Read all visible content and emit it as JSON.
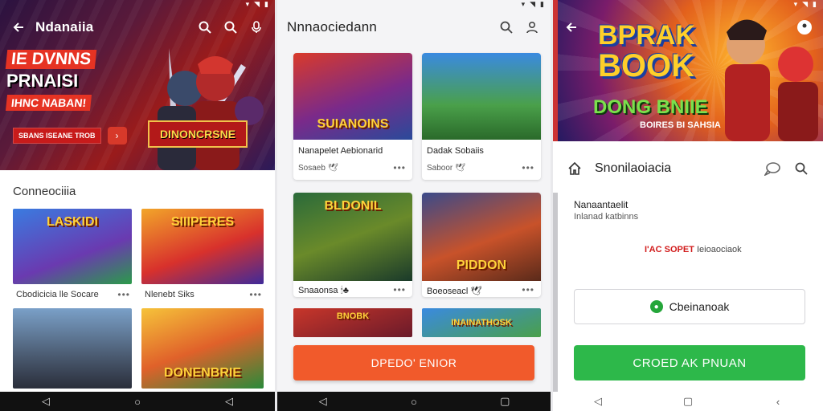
{
  "status_icons": {
    "signal": "▾",
    "wifi": "◥",
    "battery": "▮"
  },
  "phone1": {
    "title": "Ndanaiia",
    "promo": {
      "line1": "IE DVNNS",
      "line2": "PRNAISI",
      "line3": "IHNC NABAN!",
      "cta": "SBANS ISEANE TROB",
      "arrow": "›"
    },
    "hero_logo": "DINONCRSNE",
    "section_title": "Conneociiia",
    "games": [
      {
        "banner": "LASKIDI",
        "title": "Cbodicicia lle Socare"
      },
      {
        "banner": "SIIIPERES",
        "title": "Nlenebt Siks"
      },
      {
        "banner": "",
        "title": ""
      },
      {
        "banner": "DONENBRIE",
        "title": ""
      }
    ]
  },
  "phone2": {
    "title": "Nnnaociedann",
    "cards": [
      {
        "banner": "SUIANOINS",
        "title": "Nanapelet Aebionarid",
        "sub": "Sosaeb 🕊"
      },
      {
        "banner": "",
        "title": "Dadak Sobaiis",
        "sub": "Saboor 🕊"
      },
      {
        "banner": "BLDONIL",
        "title": "Snaaonsa 🕯♣",
        "sub": ""
      },
      {
        "banner": "PIDDON",
        "title": "Boeoseacl 🕊",
        "sub": ""
      },
      {
        "banner": "BNOBK",
        "title": "",
        "sub": ""
      },
      {
        "banner": "INAINATHOSK",
        "title": "",
        "sub": ""
      }
    ],
    "cta": "DPEDO' ENIOR"
  },
  "phone3": {
    "hero_title_1": "BPRAK",
    "hero_title_2": "BOOK",
    "hero_sub": "DONG BNIIE",
    "hero_small": "BOIRES BI SAHSIA",
    "detail_title": "Snonilaoiacia",
    "info_title": "Nanaantaelit",
    "info_sub": "Inlanad katbinns",
    "promo_red": "I'AC SOPET",
    "promo_rest": "Ieioaociaok",
    "secondary_button": "Cbeinanoak",
    "primary_button": "CROED AK PNUAN"
  },
  "colors": {
    "orange_cta": "#f15a2b",
    "green_cta": "#2db84a",
    "promo_red": "#e63323"
  }
}
